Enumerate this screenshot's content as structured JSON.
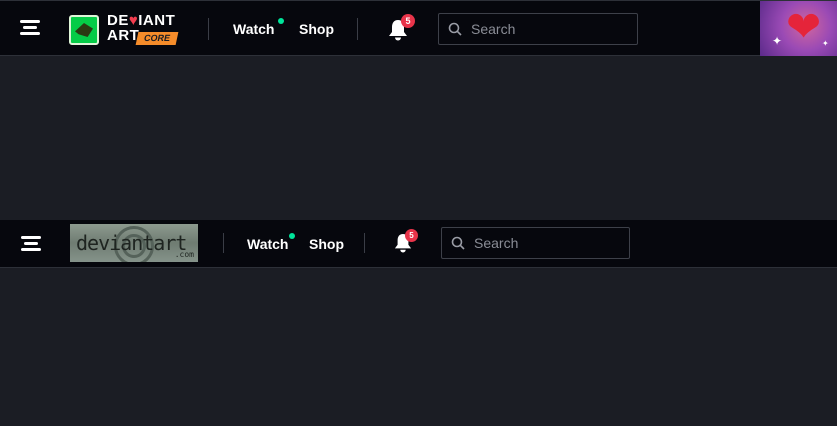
{
  "header_core": {
    "logo": {
      "word1_a": "DE",
      "word1_heart": "♥",
      "word1_b": "IANT",
      "word2": "ART",
      "tag": "CORE"
    },
    "nav": {
      "watch": "Watch",
      "shop": "Shop"
    },
    "notifications": {
      "count": "5"
    },
    "search": {
      "placeholder": "Search",
      "value": ""
    },
    "avatar": {
      "icon": "heart-icon"
    }
  },
  "header_classic": {
    "logo": {
      "text": "deviantart",
      "dotcom": ".com"
    },
    "nav": {
      "watch": "Watch",
      "shop": "Shop"
    },
    "notifications": {
      "count": "5"
    },
    "search": {
      "placeholder": "Search",
      "value": ""
    }
  },
  "colors": {
    "background": "#1b1d24",
    "bar": "#06070d",
    "watch_dot": "#00e59b",
    "badge": "#e8344a",
    "core_tag": "#f58c2a",
    "brand_green": "#05cc47"
  }
}
